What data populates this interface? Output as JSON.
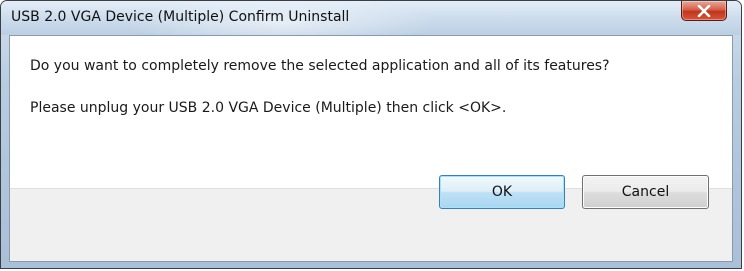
{
  "window": {
    "title": "USB 2.0 VGA Device (Multiple) Confirm Uninstall",
    "close_icon": "close-icon"
  },
  "message": {
    "line1": "Do you want to completely remove the selected application and all of its features?",
    "line2": "Please unplug your USB 2.0 VGA Device (Multiple) then click <OK>."
  },
  "buttons": {
    "ok_label": "OK",
    "cancel_label": "Cancel"
  },
  "colors": {
    "close_button": "#c1351c",
    "default_button_border": "#3c7fb1",
    "footer_background": "#f0f0f0"
  }
}
